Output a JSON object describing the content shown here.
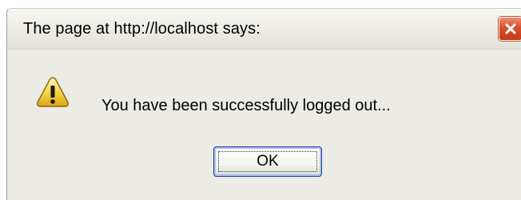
{
  "dialog": {
    "title": "The page at http://localhost says:",
    "close_icon": "close-icon",
    "warning_icon": "warning-icon",
    "message": "You have been successfully logged out...",
    "ok_label": "OK"
  },
  "colors": {
    "dialog_background": "#ecebe5",
    "close_button": "#d9502c",
    "button_border": "#1f3f9a",
    "warning_yellow": "#f7d54a"
  }
}
